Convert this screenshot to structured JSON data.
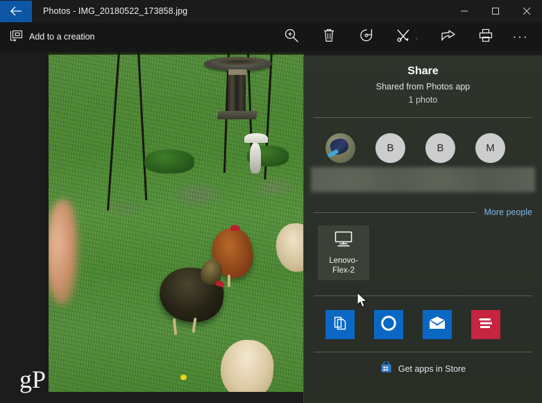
{
  "window": {
    "title": "Photos - IMG_20180522_173858.jpg",
    "back_icon": "back-arrow-icon",
    "minimize_label": "—",
    "maximize_label": "□",
    "close_label": "✕"
  },
  "toolbar": {
    "add_to_creation_label": "Add to a creation",
    "add_to_creation_icon": "add-to-creation-icon",
    "items": [
      {
        "name": "zoom-icon",
        "tip": "Zoom"
      },
      {
        "name": "delete-icon",
        "tip": "Delete"
      },
      {
        "name": "rotate-icon",
        "tip": "Rotate"
      },
      {
        "name": "edit-create-icon",
        "tip": "Edit & Create"
      },
      {
        "name": "share-icon",
        "tip": "Share"
      },
      {
        "name": "print-icon",
        "tip": "Print"
      }
    ],
    "chevron": "⌄",
    "more_label": "···"
  },
  "photo": {
    "watermark": "gP",
    "alt": "Chickens on a green lawn with a birdbath and garden stakes"
  },
  "share_panel": {
    "title": "Share",
    "subtitle": "Shared from Photos app",
    "count": "1 photo",
    "contacts": [
      {
        "name": "contact-avatar-photo",
        "initial": ""
      },
      {
        "name": "contact-avatar-b1",
        "initial": "B"
      },
      {
        "name": "contact-avatar-b2",
        "initial": "B"
      },
      {
        "name": "contact-avatar-m",
        "initial": "M"
      }
    ],
    "more_people_label": "More people",
    "devices": [
      {
        "name": "device-lenovo-flex-2",
        "label": "Lenovo-Flex-2",
        "icon": "monitor-icon"
      }
    ],
    "apps": [
      {
        "name": "app-copy",
        "icon": "copy-icon",
        "color": "#0a68c4"
      },
      {
        "name": "app-cortana",
        "icon": "cortana-ring-icon",
        "color": "#0a68c4"
      },
      {
        "name": "app-mail",
        "icon": "mail-envelope-icon",
        "color": "#0a68c4"
      },
      {
        "name": "app-notes",
        "icon": "lines-icon",
        "color": "#c62440"
      }
    ],
    "store_label": "Get apps in Store",
    "store_icon": "store-bag-icon"
  },
  "colors": {
    "accent_blue": "#0d56a6",
    "link_blue": "#7fb6e8",
    "panel_bg": "#2b302a",
    "tile_bg": "#3c4138",
    "red_app": "#c62440"
  }
}
